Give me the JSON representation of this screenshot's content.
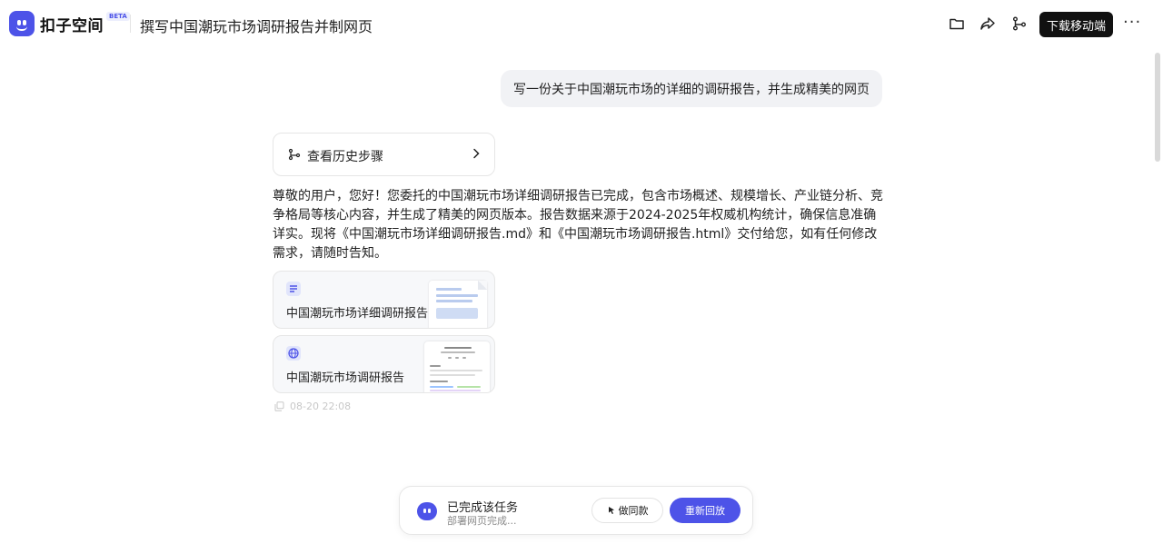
{
  "header": {
    "brand": "扣子空间",
    "beta": "BETA",
    "title": "撰写中国潮玩市场调研报告并制网页",
    "download_label": "下载移动端",
    "more_label": "···",
    "icons": [
      "folder-icon",
      "share-icon",
      "branch-icon",
      "more-icon"
    ]
  },
  "conversation": {
    "user_message": "写一份关于中国潮玩市场的详细的调研报告，并生成精美的网页",
    "history_label": "查看历史步骤",
    "reply_text": "尊敬的用户，您好！您委托的中国潮玩市场详细调研报告已完成，包含市场概述、规模增长、产业链分析、竞争格局等核心内容，并生成了精美的网页版本。报告数据来源于2024-2025年权威机构统计，确保信息准确详实。现将《中国潮玩市场详细调研报告.md》和《中国潮玩市场调研报告.html》交付给您，如有任何修改需求，请随时告知。",
    "files": [
      {
        "label": "中国潮玩市场详细调研报告",
        "icon": "document-icon"
      },
      {
        "label": "中国潮玩市场调研报告",
        "icon": "globe-icon"
      }
    ],
    "timestamp": "08-20 22:08"
  },
  "status": {
    "title": "已完成该任务",
    "subtitle": "部署网页完成...",
    "same_label": "做同款",
    "replay_label": "重新回放"
  },
  "colors": {
    "accent": "#4d53e8",
    "dark_button": "#111111",
    "bubble_bg": "#f1f2f5"
  }
}
